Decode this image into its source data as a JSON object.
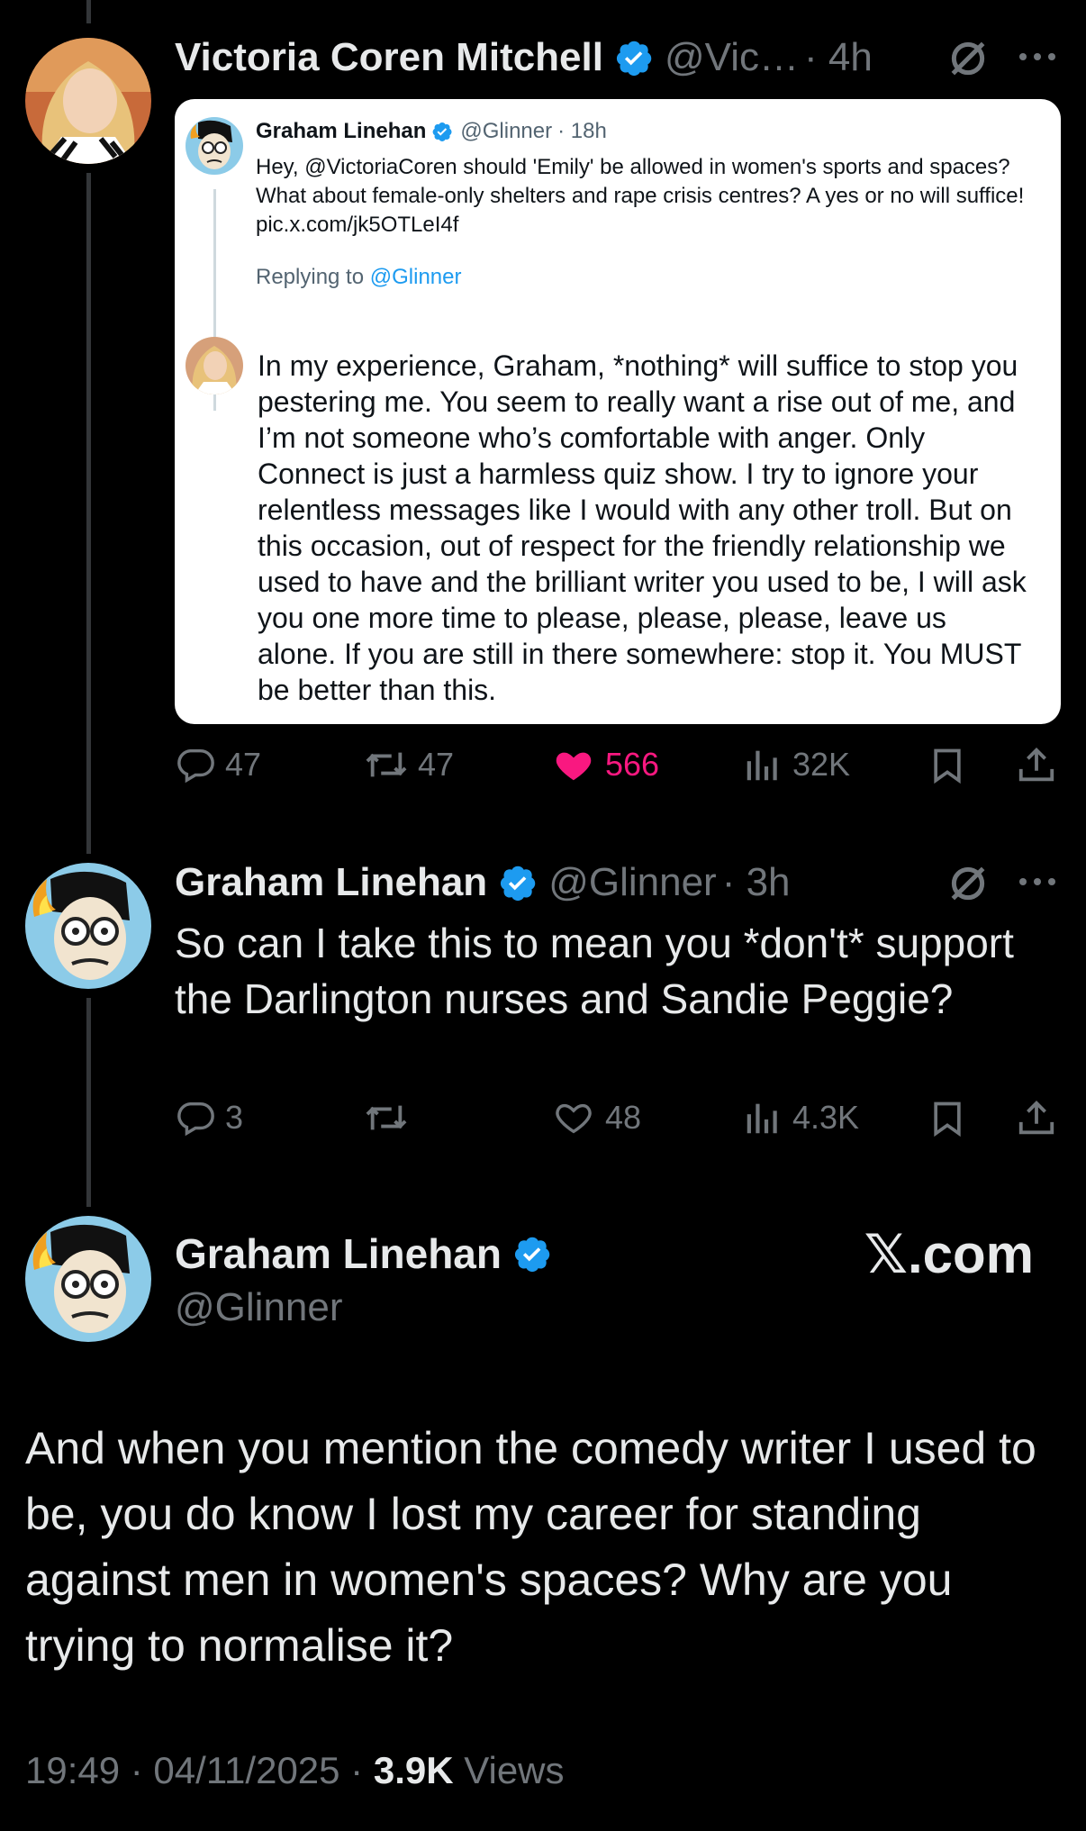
{
  "colors": {
    "background": "#000000",
    "text": "#e7e9ea",
    "muted": "#71767b",
    "verified": "#1d9bf0",
    "like_active": "#f91880",
    "card_bg": "#ffffff"
  },
  "tweet1": {
    "name": "Victoria Coren Mitchell",
    "handle": "@Vic…",
    "time": "· 4h",
    "grok_icon": "slash-circle-icon",
    "more_icon": "more-icon",
    "quote": {
      "name": "Graham Linehan",
      "handle": "@Glinner",
      "time": "· 18h",
      "text": "Hey, @VictoriaCoren should 'Emily' be allowed in women's sports and spaces? What about female-only shelters and rape crisis centres? A yes or no will suffice! pic.x.com/jk5OTLeI4f",
      "replying_prefix": "Replying to ",
      "replying_handle": "@Glinner",
      "reply_text": "In my experience, Graham, *nothing* will suffice to stop you pestering me. You seem to really want a rise out of me, and I’m not someone who’s comfortable with anger. Only Connect is just a harmless quiz show. I try to ignore your relentless messages like I would with any other troll. But on this occasion, out of respect for the friendly relationship we used to have and the brilliant writer you used to be, I will ask you one more time to please, please, please, leave us alone. If you are still in there somewhere: stop it. You MUST be better than this."
    },
    "actions": {
      "replies": "47",
      "reposts": "47",
      "likes": "566",
      "views": "32K"
    }
  },
  "tweet2": {
    "name": "Graham Linehan",
    "handle": "@Glinner",
    "time": "· 3h",
    "text": "So can I take this to mean you *don't* support the Darlington nurses and Sandie Peggie?",
    "actions": {
      "replies": "3",
      "reposts": "",
      "likes": "48",
      "views": "4.3K"
    }
  },
  "tweet3": {
    "name": "Graham Linehan",
    "handle": "@Glinner",
    "text": "And when you mention the comedy writer I used to be, you do know I lost my career for standing against men in women's spaces? Why are you trying to normalise it?",
    "timestamp": "19:49 · 04/11/2025 · ",
    "views_count": "3.9K",
    "views_label": " Views"
  },
  "watermark": "𝕏.com"
}
